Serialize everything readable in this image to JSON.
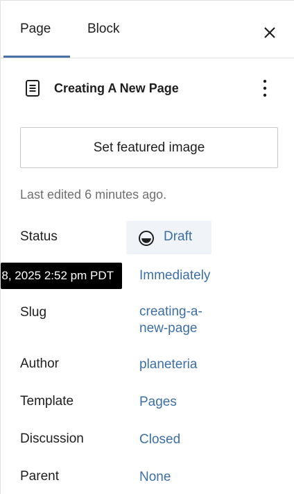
{
  "tabs": {
    "page_label": "Page",
    "block_label": "Block",
    "active": "Page"
  },
  "document": {
    "title": "Creating A New Page"
  },
  "featured_image": {
    "button_label": "Set featured image"
  },
  "last_edited": "Last edited 6 minutes ago.",
  "rows": {
    "status": {
      "label": "Status",
      "value": "Draft"
    },
    "publish": {
      "value": "Immediately",
      "tooltip": "8, 2025 2:52 pm PDT"
    },
    "slug": {
      "label": "Slug",
      "value_line1": "creating-a-",
      "value_line2": "new-page"
    },
    "author": {
      "label": "Author",
      "value": "planeteria"
    },
    "template": {
      "label": "Template",
      "value": "Pages"
    },
    "discussion": {
      "label": "Discussion",
      "value": "Closed"
    },
    "parent": {
      "label": "Parent",
      "value": "None"
    }
  },
  "icons": {
    "close": "close-icon",
    "document": "page-icon",
    "more": "more-vertical-icon",
    "status": "draft-status-icon"
  },
  "colors": {
    "accent": "#3b6fa6",
    "tab_underline": "#4a6fa5",
    "tooltip_bg": "#000000"
  }
}
